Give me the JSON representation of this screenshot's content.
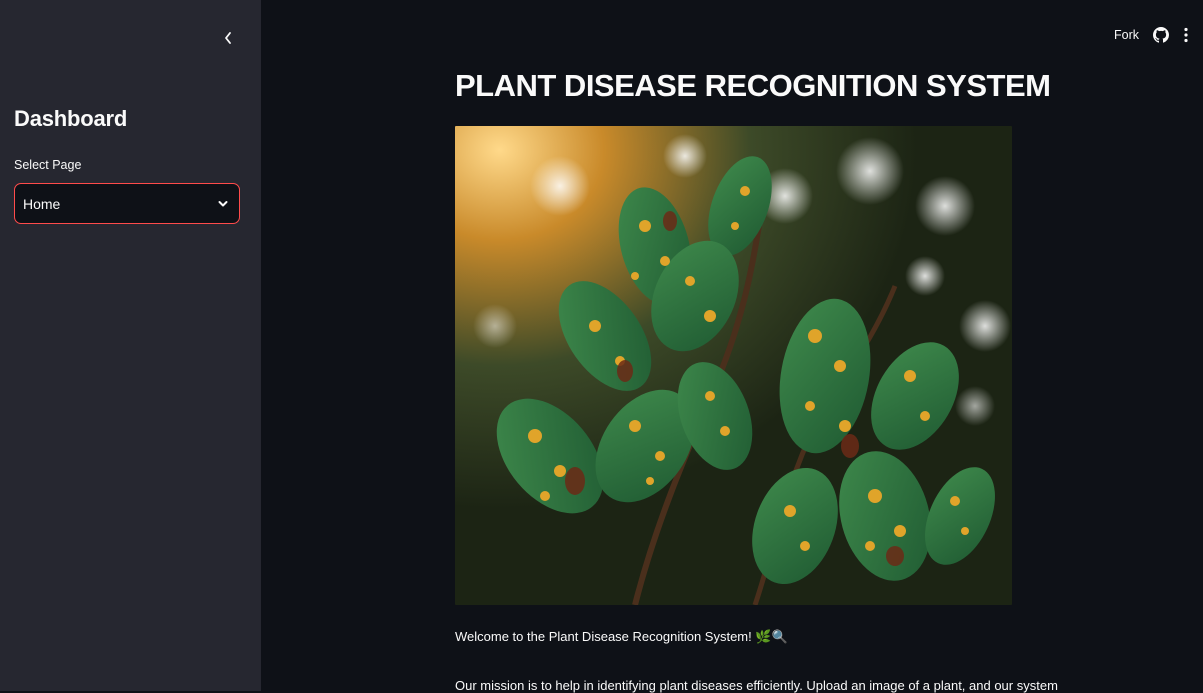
{
  "sidebar": {
    "title": "Dashboard",
    "select_label": "Select Page",
    "select_value": "Home",
    "collapse_icon": "chevron-left-icon"
  },
  "header": {
    "fork_label": "Fork",
    "github_icon": "github-icon",
    "menu_icon": "kebab-menu-icon"
  },
  "main": {
    "title": "PLANT DISEASE RECOGNITION SYSTEM",
    "welcome_text": "Welcome to the Plant Disease Recognition System! 🌿🔍",
    "mission_text": "Our mission is to help in identifying plant diseases efficiently. Upload an image of a plant, and our system"
  },
  "colors": {
    "app_background": "#0e1117",
    "sidebar_background": "#262730",
    "accent": "#ff4b4b",
    "text": "#fafafa"
  }
}
